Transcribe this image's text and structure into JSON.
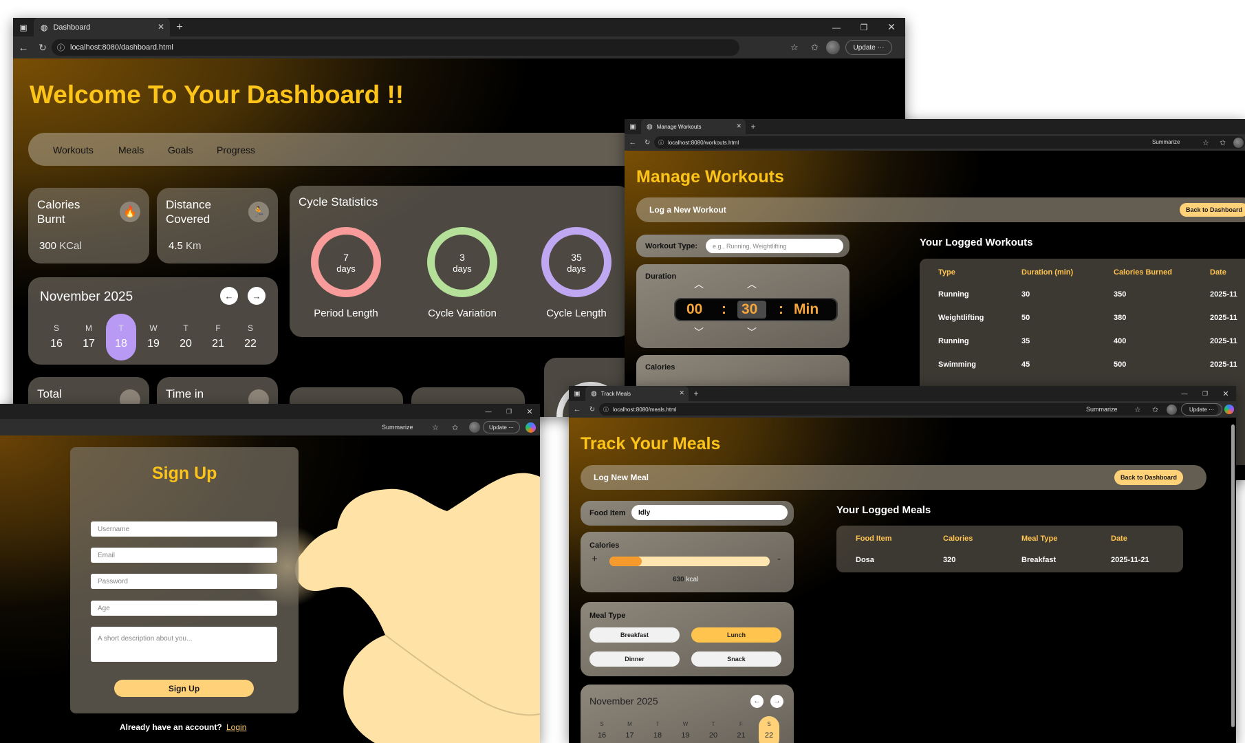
{
  "dashboard": {
    "tab_title": "Dashboard",
    "url": "localhost:8080/dashboard.html",
    "update_label": "Update",
    "heading": "Welcome To Your Dashboard !!",
    "nav": [
      "Workouts",
      "Meals",
      "Goals",
      "Progress"
    ],
    "calories": {
      "label_line1": "Calories",
      "label_line2": "Burnt",
      "value": "300",
      "unit": "KCal"
    },
    "distance": {
      "label_line1": "Distance",
      "label_line2": "Covered",
      "value": "4.5",
      "unit": "Km"
    },
    "cycle": {
      "title": "Cycle Statistics",
      "rings": [
        {
          "value": "7",
          "unit": "days",
          "label": "Period Length",
          "color": "#f79b9b"
        },
        {
          "value": "3",
          "unit": "days",
          "label": "Cycle Variation",
          "color": "#b4e09a"
        },
        {
          "value": "35",
          "unit": "days",
          "label": "Cycle Length",
          "color": "#bfa7f2"
        }
      ]
    },
    "calendar": {
      "month": "November 2025",
      "prev": "←",
      "next": "→",
      "days": [
        {
          "d": "S",
          "n": "16"
        },
        {
          "d": "M",
          "n": "17"
        },
        {
          "d": "T",
          "n": "18"
        },
        {
          "d": "W",
          "n": "19"
        },
        {
          "d": "T",
          "n": "20"
        },
        {
          "d": "F",
          "n": "21"
        },
        {
          "d": "S",
          "n": "22"
        }
      ],
      "selected_index": 2
    },
    "bottom_cards": [
      "Total",
      "Time in"
    ]
  },
  "workouts": {
    "tab_title": "Manage Workouts",
    "url": "localhost:8080/workouts.html",
    "summarize": "Summarize",
    "heading": "Manage Workouts",
    "bar_label": "Log a New Workout",
    "back_button": "Back to Dashboard",
    "type_label": "Workout Type:",
    "type_placeholder": "e.g., Running, Weightlifting",
    "duration_label": "Duration",
    "hours": "00",
    "minutes": "30",
    "unit": "Min",
    "calories_label": "Calories",
    "table_title": "Your Logged Workouts",
    "columns": [
      "Type",
      "Duration (min)",
      "Calories Burned",
      "Date"
    ],
    "rows": [
      [
        "Running",
        "30",
        "350",
        "2025-11"
      ],
      [
        "Weightlifting",
        "50",
        "380",
        "2025-11"
      ],
      [
        "Running",
        "35",
        "400",
        "2025-11"
      ],
      [
        "Swimming",
        "45",
        "500",
        "2025-11"
      ]
    ]
  },
  "signup": {
    "summarize": "Summarize",
    "update_label": "Update",
    "heading": "Sign Up",
    "fields": [
      "Username",
      "Email",
      "Password",
      "Age"
    ],
    "description_placeholder": "A short description about you...",
    "button": "Sign Up",
    "footer_text": "Already have an account?",
    "login_link": "Login"
  },
  "meals": {
    "tab_title": "Track Meals",
    "url": "localhost:8080/meals.html",
    "summarize": "Summarize",
    "update_label": "Update",
    "heading": "Track Your Meals",
    "bar_label": "Log New Meal",
    "back_button": "Back to Dashboard",
    "food_label": "Food Item",
    "food_value": "Idly",
    "calories_label": "Calories",
    "calories_value": "630",
    "calories_unit": "kcal",
    "calories_fraction": 0.2,
    "meal_type_label": "Meal Type",
    "meal_types": [
      "Breakfast",
      "Lunch",
      "Dinner",
      "Snack"
    ],
    "selected_meal_type": "Lunch",
    "calendar": {
      "month": "November 2025",
      "prev": "←",
      "next": "→",
      "days": [
        {
          "d": "S",
          "n": "16"
        },
        {
          "d": "M",
          "n": "17"
        },
        {
          "d": "T",
          "n": "18"
        },
        {
          "d": "W",
          "n": "19"
        },
        {
          "d": "T",
          "n": "20"
        },
        {
          "d": "F",
          "n": "21"
        },
        {
          "d": "S",
          "n": "22"
        }
      ]
    },
    "table_title": "Your Logged Meals",
    "columns": [
      "Food Item",
      "Calories",
      "Meal Type",
      "Date"
    ],
    "rows": [
      [
        "Dosa",
        "320",
        "Breakfast",
        "2025-11-21"
      ]
    ]
  },
  "colors": {
    "accent_yellow": "#fcc419",
    "cream": "#ffd27a",
    "highlight_purple": "#b89af5"
  },
  "icons": [
    "fire-icon",
    "runner-icon",
    "shoe-icon",
    "clock-icon",
    "globe-icon",
    "refresh-icon",
    "back-icon"
  ]
}
